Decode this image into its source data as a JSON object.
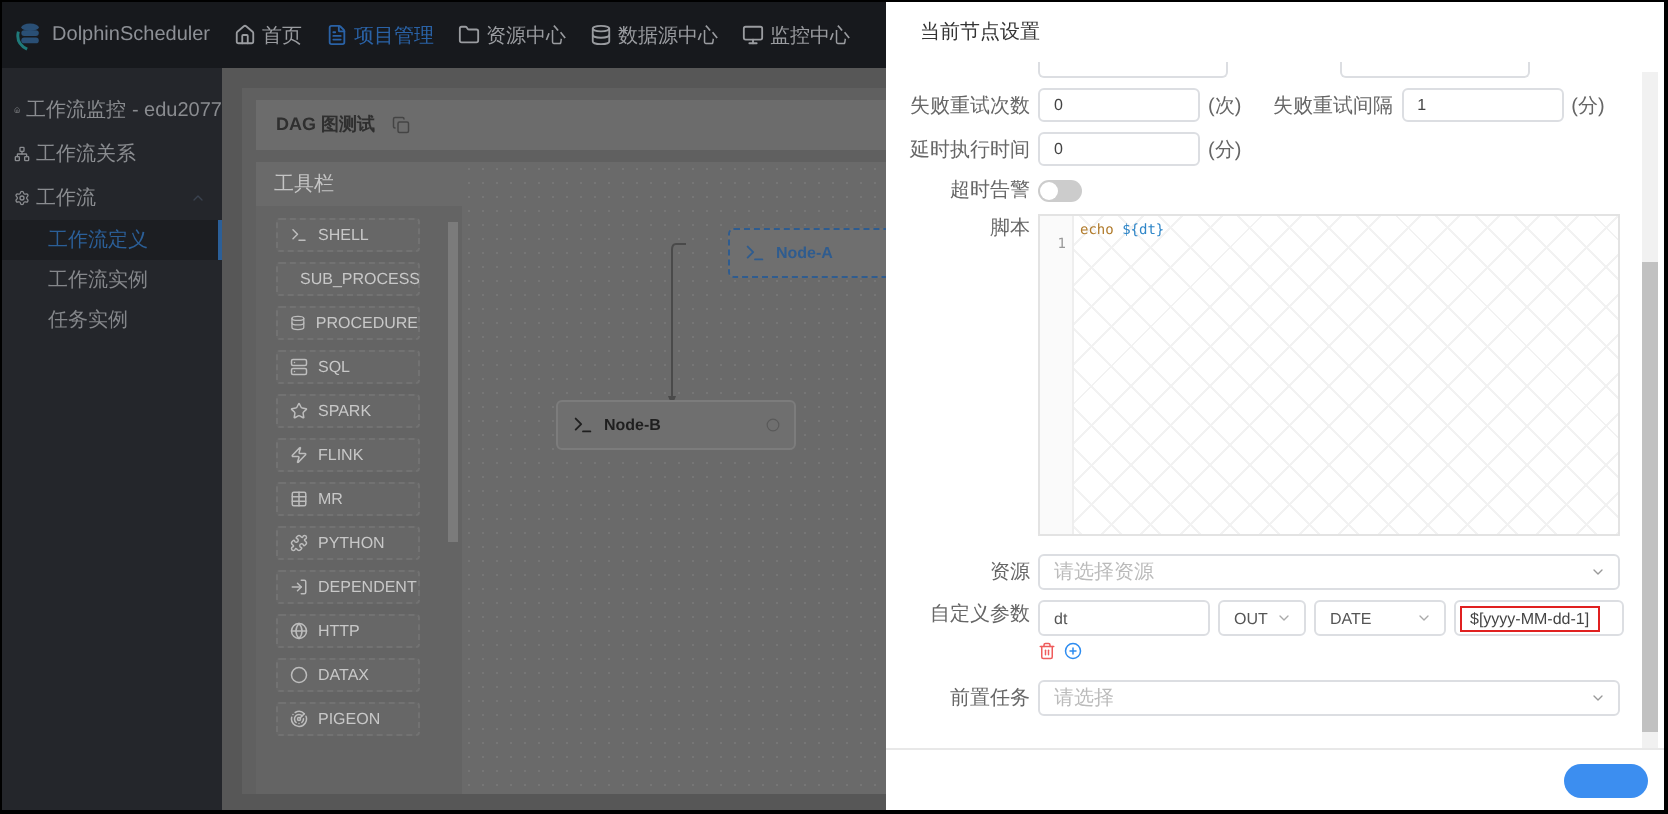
{
  "header": {
    "logo": "DolphinScheduler",
    "nav": [
      {
        "label": "首页",
        "selected": false
      },
      {
        "label": "项目管理",
        "selected": true
      },
      {
        "label": "资源中心",
        "selected": false
      },
      {
        "label": "数据源中心",
        "selected": false
      },
      {
        "label": "监控中心",
        "selected": false
      }
    ]
  },
  "sidebar": {
    "items": [
      {
        "label": "工作流监控 - edu2077",
        "expanded": false
      },
      {
        "label": "工作流关系",
        "expanded": false
      },
      {
        "label": "工作流",
        "expanded": true,
        "children": [
          {
            "label": "工作流定义",
            "selected": true
          },
          {
            "label": "工作流实例",
            "selected": false
          },
          {
            "label": "任务实例",
            "selected": false
          }
        ]
      }
    ]
  },
  "dag": {
    "title": "DAG 图测试",
    "toolbar_title": "工具栏",
    "tools": [
      "SHELL",
      "SUB_PROCESS",
      "PROCEDURE",
      "SQL",
      "SPARK",
      "FLINK",
      "MR",
      "PYTHON",
      "DEPENDENT",
      "HTTP",
      "DATAX",
      "PIGEON"
    ],
    "nodes": [
      {
        "label": "Node-A",
        "selected": true
      },
      {
        "label": "Node-B",
        "selected": false
      }
    ]
  },
  "drawer": {
    "title": "当前节点设置",
    "retry_times": {
      "label": "失败重试次数",
      "value": "0",
      "unit": "(次)"
    },
    "retry_interval": {
      "label": "失败重试间隔",
      "value": "1",
      "unit": "(分)"
    },
    "delay": {
      "label": "延时执行时间",
      "value": "0",
      "unit": "(分)"
    },
    "timeout_alarm": {
      "label": "超时告警",
      "on": false
    },
    "script": {
      "label": "脚本",
      "lines": [
        {
          "number": "1",
          "tokens": [
            {
              "kind": "keyword",
              "text": "echo"
            },
            {
              "kind": "variable",
              "text": "${dt}"
            }
          ]
        }
      ]
    },
    "resource": {
      "label": "资源",
      "placeholder": "请选择资源"
    },
    "params": {
      "label": "自定义参数",
      "rows": [
        {
          "prop": "dt",
          "direct": "OUT",
          "type": "DATE",
          "value": "$[yyyy-MM-dd-1]",
          "highlighted": true
        }
      ]
    },
    "pre_task": {
      "label": "前置任务",
      "placeholder": "请选择"
    }
  }
}
